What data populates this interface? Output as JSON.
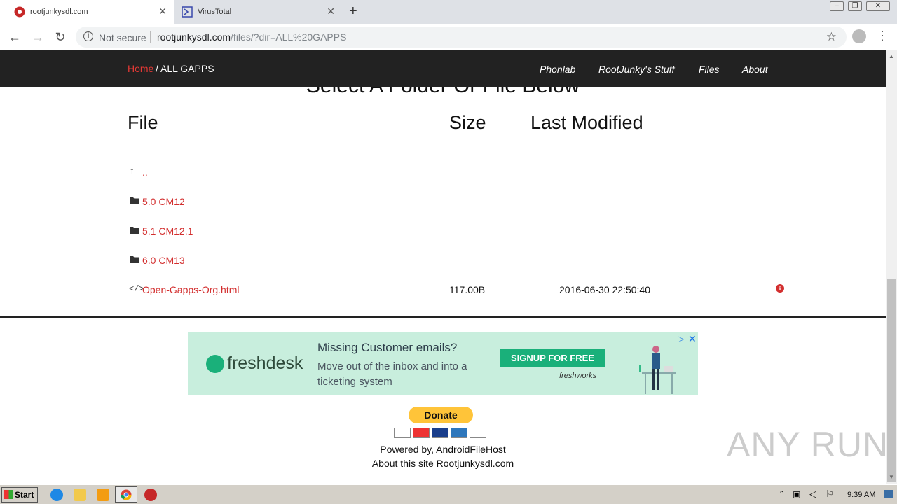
{
  "browser": {
    "tabs": [
      {
        "title": "rootjunkysdl.com",
        "active": true
      },
      {
        "title": "VirusTotal",
        "active": false
      }
    ],
    "omnibox": {
      "security_label": "Not secure",
      "url_host": "rootjunkysdl.com",
      "url_path": "/files/?dir=ALL%20GAPPS"
    }
  },
  "site": {
    "breadcrumb": {
      "home": "Home",
      "current": "/ ALL GAPPS"
    },
    "nav": [
      "Phonlab",
      "RootJunky's Stuff",
      "Files",
      "About"
    ],
    "heading": "Select A Folder Or File Below",
    "columns": {
      "file": "File",
      "size": "Size",
      "modified": "Last Modified"
    },
    "rows": [
      {
        "icon": "up-arrow-icon",
        "name": "..",
        "size": "",
        "modified": ""
      },
      {
        "icon": "folder-icon",
        "name": "5.0 CM12",
        "size": "",
        "modified": ""
      },
      {
        "icon": "folder-icon",
        "name": "5.1 CM12.1",
        "size": "",
        "modified": ""
      },
      {
        "icon": "folder-icon",
        "name": "6.0 CM13",
        "size": "",
        "modified": ""
      },
      {
        "icon": "code-icon",
        "name": "Open-Gapps-Org.html",
        "size": "117.00B",
        "modified": "2016-06-30 22:50:40"
      }
    ]
  },
  "ad": {
    "brand": "freshdesk",
    "headline": "Missing Customer emails?",
    "body": "Move out of the inbox and into a ticketing system",
    "cta": "SIGNUP FOR FREE",
    "sub_brand": "freshworks"
  },
  "footer": {
    "donate": "Donate",
    "powered_by": "Powered by, AndroidFileHost",
    "about": "About this site Rootjunkysdl.com"
  },
  "watermark": "ANY RUN",
  "taskbar": {
    "start_label": "Start",
    "clock": "9:39 AM"
  },
  "colors": {
    "link": "#d32f2f",
    "header_bg": "#222222",
    "ad_bg": "#c8eedd",
    "cta": "#1ab07a"
  }
}
